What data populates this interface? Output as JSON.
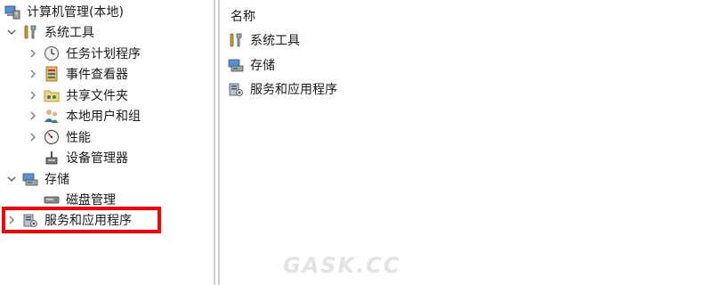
{
  "tree": {
    "root": {
      "label": "计算机管理(本地)",
      "icon": "computer-management-icon"
    },
    "system_tools": {
      "label": "系统工具",
      "icon": "tools-icon",
      "expanded": true
    },
    "task_scheduler": {
      "label": "任务计划程序",
      "icon": "clock-icon"
    },
    "event_viewer": {
      "label": "事件查看器",
      "icon": "event-viewer-icon"
    },
    "shared_folders": {
      "label": "共享文件夹",
      "icon": "shared-folder-icon"
    },
    "local_users": {
      "label": "本地用户和组",
      "icon": "users-icon"
    },
    "performance": {
      "label": "性能",
      "icon": "performance-icon"
    },
    "device_manager": {
      "label": "设备管理器",
      "icon": "device-manager-icon"
    },
    "storage": {
      "label": "存储",
      "icon": "storage-icon",
      "expanded": true
    },
    "disk_management": {
      "label": "磁盘管理",
      "icon": "disk-icon"
    },
    "services_apps": {
      "label": "服务和应用程序",
      "icon": "services-icon",
      "highlighted": true
    }
  },
  "list": {
    "header": "名称",
    "items": [
      {
        "label": "系统工具",
        "icon": "tools-icon"
      },
      {
        "label": "存储",
        "icon": "storage-icon"
      },
      {
        "label": "服务和应用程序",
        "icon": "services-icon"
      }
    ]
  },
  "watermark": "GASK.CC",
  "colors": {
    "highlight": "#ff0000",
    "splitter": "#cfcfcf",
    "watermark": "#e3e3e3"
  }
}
